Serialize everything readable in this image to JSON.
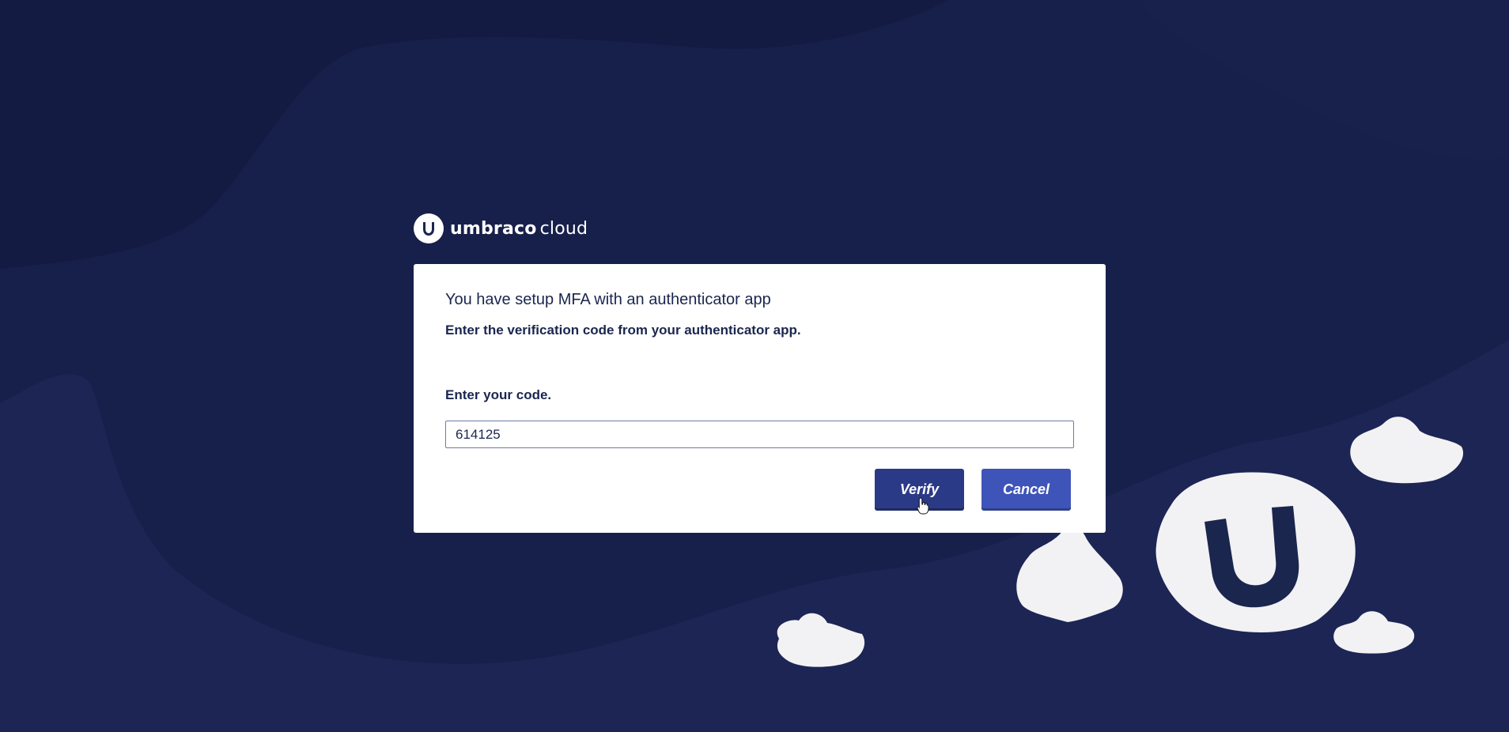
{
  "brand": {
    "name_bold": "umbraco",
    "name_light": "cloud",
    "logo_icon": "umbraco-u-icon"
  },
  "dialog": {
    "title": "You have setup MFA with an authenticator app",
    "description": "Enter the verification code from your authenticator app.",
    "code_label": "Enter your code.",
    "code_value": "614125",
    "verify_label": "Verify",
    "cancel_label": "Cancel"
  },
  "colors": {
    "background": "#1b2350",
    "background_dark": "#161d45",
    "verify_button": "#2b3a86",
    "cancel_button": "#3f54b8",
    "card": "#ffffff"
  },
  "icons": {
    "cursor": "hand-pointer-icon"
  }
}
